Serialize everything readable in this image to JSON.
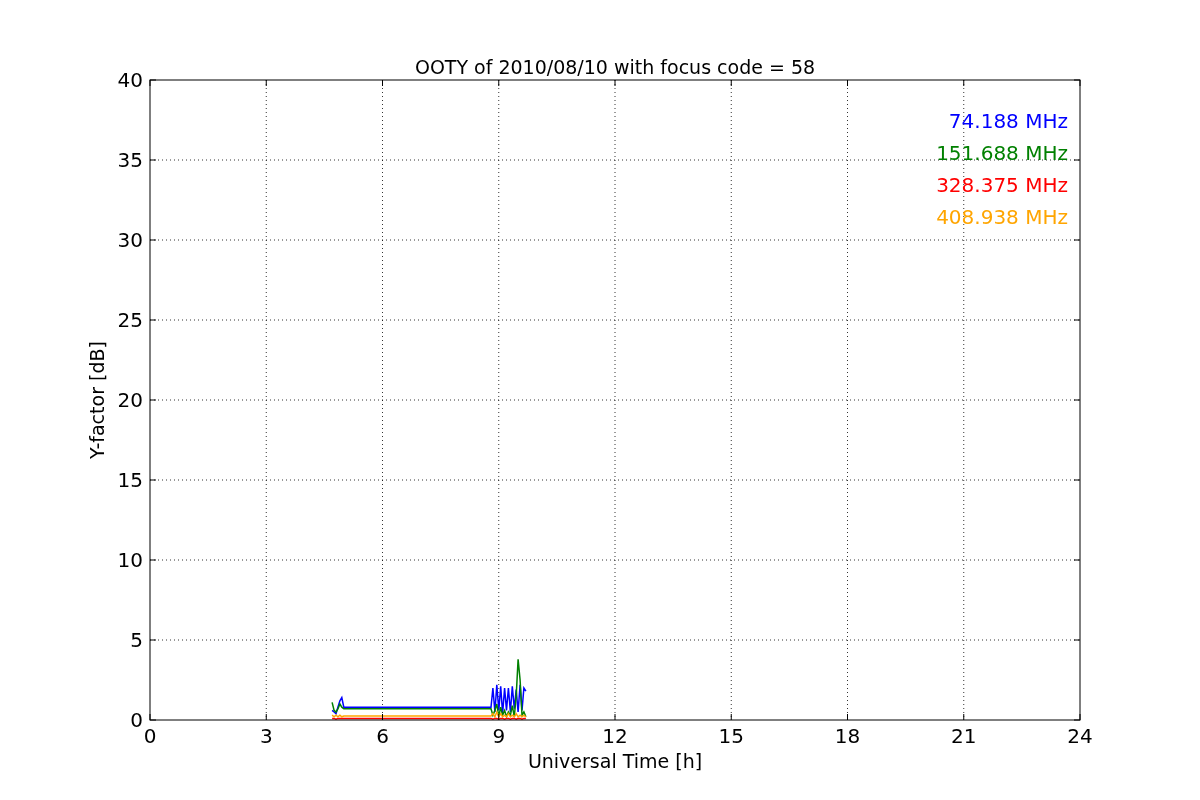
{
  "chart_data": {
    "type": "line",
    "title": "OOTY of 2010/08/10 with focus code = 58",
    "xlabel": "Universal Time [h]",
    "ylabel": "Y-factor [dB]",
    "x": [
      4.7,
      4.75,
      4.8,
      4.85,
      4.9,
      4.95,
      5.0,
      8.8,
      8.85,
      8.9,
      8.95,
      9.0,
      9.05,
      9.1,
      9.15,
      9.2,
      9.25,
      9.3,
      9.35,
      9.4,
      9.45,
      9.5,
      9.55,
      9.6,
      9.65,
      9.7
    ],
    "series": [
      {
        "name": "74.188 MHz",
        "color": "#0000ff",
        "values": [
          0.6,
          0.5,
          0.4,
          0.8,
          1.2,
          1.4,
          0.8,
          0.8,
          2.0,
          0.5,
          2.2,
          0.6,
          2.1,
          0.4,
          2.0,
          0.6,
          2.0,
          0.5,
          2.1,
          0.7,
          1.9,
          0.5,
          2.2,
          0.6,
          2.0,
          1.8
        ]
      },
      {
        "name": "151.688 MHz",
        "color": "#008000",
        "values": [
          1.1,
          0.6,
          0.5,
          0.7,
          1.0,
          0.8,
          0.7,
          0.7,
          0.3,
          0.6,
          1.0,
          0.2,
          0.8,
          0.3,
          0.6,
          0.2,
          0.5,
          0.3,
          0.9,
          0.2,
          1.5,
          3.8,
          2.5,
          0.3,
          0.5,
          0.2
        ]
      },
      {
        "name": "328.375 MHz",
        "color": "#ff0000",
        "values": [
          0.1,
          0.1,
          0.05,
          0.1,
          0.1,
          0.1,
          0.1,
          0.1,
          0.05,
          0.1,
          0.1,
          0.05,
          0.1,
          0.1,
          0.05,
          0.1,
          0.1,
          0.05,
          0.1,
          0.1,
          0.05,
          0.1,
          0.1,
          0.05,
          0.1,
          0.1
        ]
      },
      {
        "name": "408.938 MHz",
        "color": "#ffa500",
        "values": [
          0.3,
          0.2,
          0.3,
          0.2,
          0.3,
          0.2,
          0.25,
          0.25,
          0.4,
          0.2,
          0.5,
          0.2,
          0.4,
          0.2,
          0.3,
          0.2,
          0.4,
          0.2,
          0.3,
          0.2,
          0.4,
          0.2,
          0.3,
          0.2,
          0.3,
          0.2
        ]
      }
    ],
    "grid": true,
    "xlim": [
      0,
      24
    ],
    "ylim": [
      0,
      40
    ],
    "xticks": [
      0,
      3,
      6,
      9,
      12,
      15,
      18,
      21,
      24
    ],
    "yticks": [
      0,
      5,
      10,
      15,
      20,
      25,
      30,
      35,
      40
    ]
  }
}
